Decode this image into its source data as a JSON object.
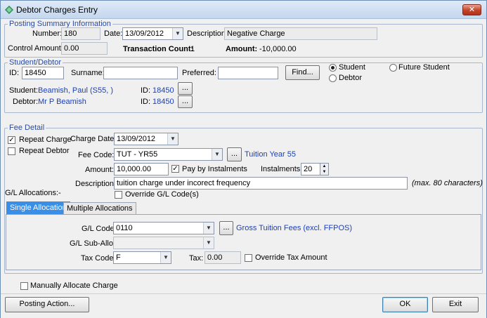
{
  "window": {
    "title": "Debtor Charges Entry",
    "close_label": "✕"
  },
  "posting": {
    "group_title": "Posting Summary Information",
    "number_label": "Number:",
    "number_value": "180",
    "date_label": "Date:",
    "date_value": "13/09/2012",
    "description_label": "Description:",
    "description_value": "Negative Charge",
    "control_amount_label": "Control Amount:",
    "control_amount_value": "0.00",
    "transaction_count_label": "Transaction Count:",
    "transaction_count_value": "1",
    "amount_label": "Amount:",
    "amount_value": "-10,000.00"
  },
  "student_debtor": {
    "group_title": "Student/Debtor",
    "id_label": "ID:",
    "id_value": "18450",
    "surname_label": "Surname:",
    "surname_value": "",
    "preferred_label": "Preferred:",
    "preferred_value": "",
    "find_label": "Find...",
    "radio_student": "Student",
    "radio_future_student": "Future Student",
    "radio_debtor": "Debtor",
    "student_label": "Student:",
    "student_value": "Beamish, Paul (S55, )",
    "student_id_label": "ID:",
    "student_id_value": "18450",
    "debtor_label": "Debtor:",
    "debtor_value": "Mr P Beamish",
    "debtor_id_label": "ID:",
    "debtor_id_value": "18450",
    "ellipsis": "..."
  },
  "fee": {
    "group_title": "Fee Detail",
    "repeat_charge_label": "Repeat Charge",
    "repeat_charge_checked": true,
    "repeat_debtor_label": "Repeat Debtor",
    "repeat_debtor_checked": false,
    "charge_date_label": "Charge Date:",
    "charge_date_value": "13/09/2012",
    "fee_code_label": "Fee Code:",
    "fee_code_value": "TUT - YR55",
    "fee_code_desc": "Tuition Year 55",
    "amount_label": "Amount:",
    "amount_value": "10,000.00",
    "pay_by_instalments_label": "Pay by Instalments",
    "pay_by_instalments_checked": true,
    "instalments_label": "Instalments:",
    "instalments_value": "20",
    "description_label": "Description:",
    "description_value": "tuition charge under incorect frequency",
    "description_hint": "(max. 80 characters)",
    "gl_allocations_label": "G/L Allocations:-",
    "override_gl_label": "Override G/L Code(s)",
    "ellipsis": "..."
  },
  "tabs": [
    {
      "label": "Single Allocation"
    },
    {
      "label": "Multiple Allocations"
    }
  ],
  "allocation": {
    "gl_code_label": "G/L Code:",
    "gl_code_value": "0110",
    "gl_code_desc": "Gross Tuition Fees (excl. FFPOS)",
    "gl_sub_alloc_label": "G/L Sub-Alloc:",
    "gl_sub_alloc_value": "",
    "tax_code_label": "Tax Code:",
    "tax_code_value": "F",
    "tax_label": "Tax:",
    "tax_value": "0.00",
    "override_tax_label": "Override Tax Amount",
    "ellipsis": "..."
  },
  "footer": {
    "manually_allocate_label": "Manually Allocate Charge",
    "posting_action_label": "Posting Action...",
    "ok_label": "OK",
    "exit_label": "Exit"
  },
  "colors": {
    "link_blue": "#1a3fb8",
    "group_title_blue": "#2b4c9e",
    "active_tab": "#3b8ee6"
  }
}
